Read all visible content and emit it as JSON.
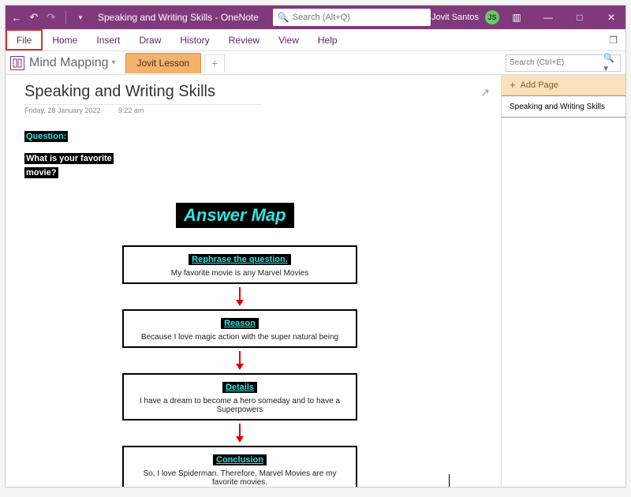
{
  "title": "Speaking and Writing Skills  -  OneNote",
  "search_placeholder": "Search (Alt+Q)",
  "user": {
    "name": "Jovit Santos",
    "initials": "JS"
  },
  "ribbon": [
    "File",
    "Home",
    "Insert",
    "Draw",
    "History",
    "Review",
    "View",
    "Help"
  ],
  "notebook": {
    "name": "Mind Mapping",
    "section": "Jovit Lesson"
  },
  "page_search_placeholder": "Search (Ctrl+E)",
  "sidebar": {
    "add_label": "Add Page",
    "pages": [
      "Speaking and Writing Skills"
    ]
  },
  "page": {
    "title": "Speaking and Writing Skills",
    "date": "Friday, 28 January 2022",
    "time": "9:22 am"
  },
  "question": {
    "label": "Question:",
    "text1": "What is your favorite",
    "text2": "movie?"
  },
  "answer_title": "Answer Map",
  "boxes": [
    {
      "head": "Rephrase the question.",
      "text": "My favorite movie is any Marvel Movies"
    },
    {
      "head": "Reason",
      "text": "Because I love magic action with the super natural being"
    },
    {
      "head": "Details",
      "text": "I have a  dream to become a hero someday and to have a Superpowers"
    },
    {
      "head": "Conclusion",
      "text": "So, I love Spiderman. Therefore, Marvel Movies are my favorite movies."
    }
  ]
}
